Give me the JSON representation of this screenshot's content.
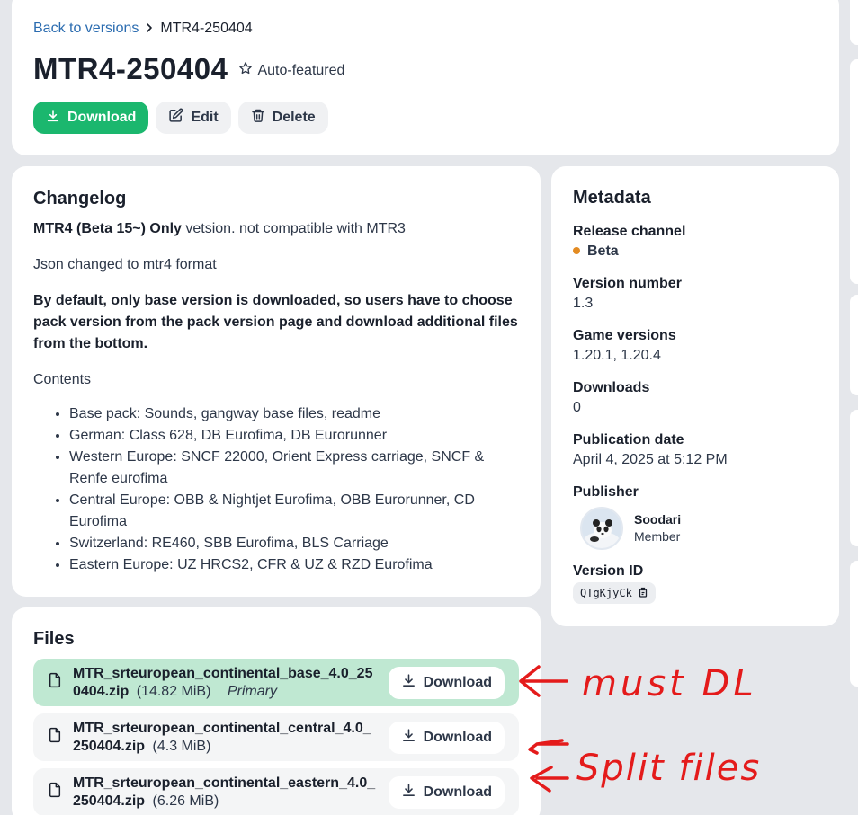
{
  "header": {
    "breadcrumb_link": "Back to versions",
    "breadcrumb_current": "MTR4-250404",
    "title": "MTR4-250404",
    "featured_label": "Auto-featured",
    "actions": {
      "download": "Download",
      "edit": "Edit",
      "delete": "Delete"
    },
    "accent_color": "#1bb76e"
  },
  "changelog": {
    "heading": "Changelog",
    "line1_bold": "MTR4 (Beta 15~) Only",
    "line1_rest": " vetsion. not compatible with MTR3",
    "line2": "Json changed to mtr4 format",
    "line3_bold": "By default, only base version is downloaded, so users have to choose pack version from the pack version page and download additional files from the bottom.",
    "line4": "Contents",
    "contents": [
      "Base pack: Sounds, gangway base files, readme",
      "German: Class 628, DB Eurofima, DB Eurorunner",
      "Western Europe: SNCF 22000, Orient Express carriage, SNCF & Renfe eurofima",
      "Central Europe: OBB & Nightjet Eurofima, OBB Eurorunner, CD Eurofima",
      "Switzerland: RE460, SBB Eurofima, BLS Carriage",
      "Eastern Europe: UZ HRCS2, CFR & UZ & RZD Eurofima"
    ]
  },
  "metadata": {
    "heading": "Metadata",
    "release_channel_label": "Release channel",
    "release_channel": "Beta",
    "release_channel_color": "#e38b22",
    "version_number_label": "Version number",
    "version_number": "1.3",
    "game_versions_label": "Game versions",
    "game_versions": "1.20.1, 1.20.4",
    "downloads_label": "Downloads",
    "downloads": "0",
    "publication_date_label": "Publication date",
    "publication_date": "April 4, 2025 at 5:12 PM",
    "publisher_label": "Publisher",
    "publisher_name": "Soodari",
    "publisher_role": "Member",
    "version_id_label": "Version ID",
    "version_id": "QTgKjyCk"
  },
  "files": {
    "heading": "Files",
    "items": [
      {
        "name": "MTR_srteuropean_continental_base_4.0_250404.zip",
        "name_l1": "MTR_srteuropean_continental_base_4.0_25",
        "name_l2": "0404.zip",
        "size": "(14.82 MiB)",
        "tag": "Primary",
        "download": "Download"
      },
      {
        "name": "MTR_srteuropean_continental_central_4.0_250404.zip",
        "name_l1": "MTR_srteuropean_continental_central_4.0_",
        "name_l2": "250404.zip",
        "size": "(4.3 MiB)",
        "download": "Download"
      },
      {
        "name": "MTR_srteuropean_continental_eastern_4.0_250404.zip",
        "name_l1": "MTR_srteuropean_continental_eastern_4.0_",
        "name_l2": "250404.zip",
        "size": "(6.26 MiB)",
        "download": "Download"
      }
    ]
  },
  "annotations": {
    "note1": "must DL",
    "note2": "Split files",
    "ink_color": "#e41b1b"
  }
}
